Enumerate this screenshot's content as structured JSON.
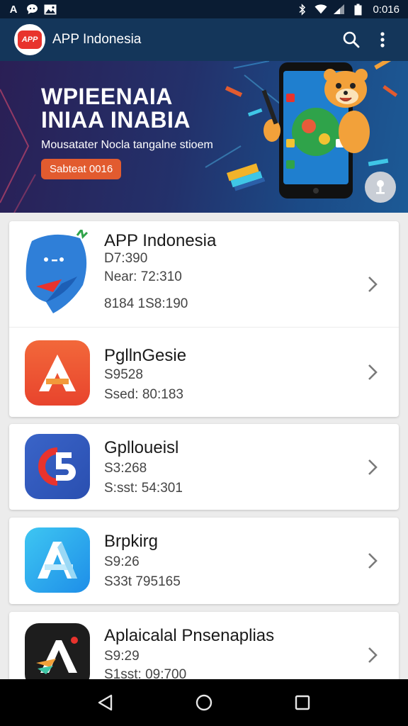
{
  "status_bar": {
    "left_icons": [
      "A",
      "chat-icon",
      "image-icon"
    ],
    "right_icons": [
      "bluetooth-icon",
      "wifi-icon",
      "signal-icon",
      "battery-icon"
    ],
    "time": "0:016"
  },
  "app_bar": {
    "logo_text": "APP",
    "title": "APP Indonesia"
  },
  "banner": {
    "headline_line1": "WPIEENAIA",
    "headline_line2": "INIAA INABIA",
    "subtitle": "Mousatater Nocla tangalne stioem",
    "cta_label": "Sabteat 0016"
  },
  "apps": [
    {
      "title": "APP Indonesia",
      "line1": "D7:390",
      "line2": "Near: 72:310",
      "line3": "8184 1S8:190",
      "icon": "blue-whale-icon"
    },
    {
      "title": "PgllnGesie",
      "line1": "S9528",
      "line2": "Ssed: 80:183",
      "icon": "orange-a-icon"
    },
    {
      "title": "Gplloueisl",
      "line1": "S3:268",
      "line2": "S:sst: 54:301",
      "icon": "c5-icon"
    },
    {
      "title": "Brpkirg",
      "line1": "S9:26",
      "line2": "S33t 795165",
      "icon": "blue-a-icon"
    },
    {
      "title": "Aplaicalal Pnsenaplias",
      "line1": "S9:29",
      "line2": "S1sst: 09:700",
      "icon": "dark-a-icon"
    }
  ],
  "colors": {
    "status_bar": "#0a1c33",
    "app_bar": "#14365a",
    "cta": "#e25b2f",
    "nav_bar": "#000000"
  }
}
